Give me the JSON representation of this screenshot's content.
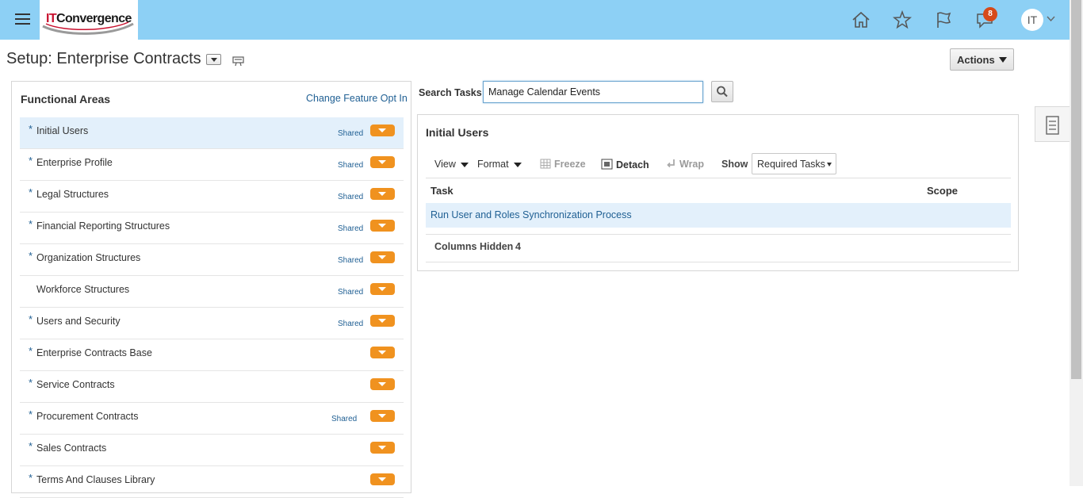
{
  "header": {
    "logo": {
      "prefix": "IT",
      "text": "Convergence"
    },
    "notification_count": "8",
    "user_initials": "IT",
    "icons": [
      "home-icon",
      "favorites-star-icon",
      "watchlist-flag-icon",
      "notifications-icon"
    ]
  },
  "page": {
    "title": "Setup: Enterprise Contracts",
    "actions_label": "Actions"
  },
  "functional_areas": {
    "title": "Functional Areas",
    "change_link": "Change Feature Opt In",
    "items": [
      {
        "label": "Initial Users",
        "required": true,
        "shared": "Shared",
        "selected": true
      },
      {
        "label": "Enterprise Profile",
        "required": true,
        "shared": "Shared"
      },
      {
        "label": "Legal Structures",
        "required": true,
        "shared": "Shared"
      },
      {
        "label": "Financial Reporting Structures",
        "required": true,
        "shared": "Shared"
      },
      {
        "label": "Organization Structures",
        "required": true,
        "shared": "Shared"
      },
      {
        "label": "Workforce Structures",
        "required": false,
        "shared": "Shared"
      },
      {
        "label": "Users and Security",
        "required": true,
        "shared": "Shared"
      },
      {
        "label": "Enterprise Contracts Base",
        "required": true,
        "shared": ""
      },
      {
        "label": "Service Contracts",
        "required": true,
        "shared": ""
      },
      {
        "label": "Procurement Contracts",
        "required": true,
        "shared": "Shared"
      },
      {
        "label": "Sales Contracts",
        "required": true,
        "shared": ""
      },
      {
        "label": "Terms And Clauses Library",
        "required": true,
        "shared": ""
      }
    ]
  },
  "search": {
    "label": "Search Tasks",
    "value": "Manage Calendar Events"
  },
  "tasks_panel": {
    "title": "Initial Users",
    "toolbar": {
      "view": "View",
      "format": "Format",
      "freeze": "Freeze",
      "detach": "Detach",
      "wrap": "Wrap",
      "show_label": "Show",
      "show_value": "Required Tasks"
    },
    "columns": {
      "task": "Task",
      "scope": "Scope"
    },
    "rows": [
      {
        "task": "Run User and Roles Synchronization Process",
        "scope": ""
      }
    ],
    "columns_hidden_label": "Columns Hidden",
    "columns_hidden_count": "4"
  },
  "colors": {
    "header_bg": "#8dd0f5",
    "link": "#1f5f93",
    "orange_button": "#f0921f",
    "selected_row": "#e3f0fb",
    "badge": "#d64a1a"
  }
}
